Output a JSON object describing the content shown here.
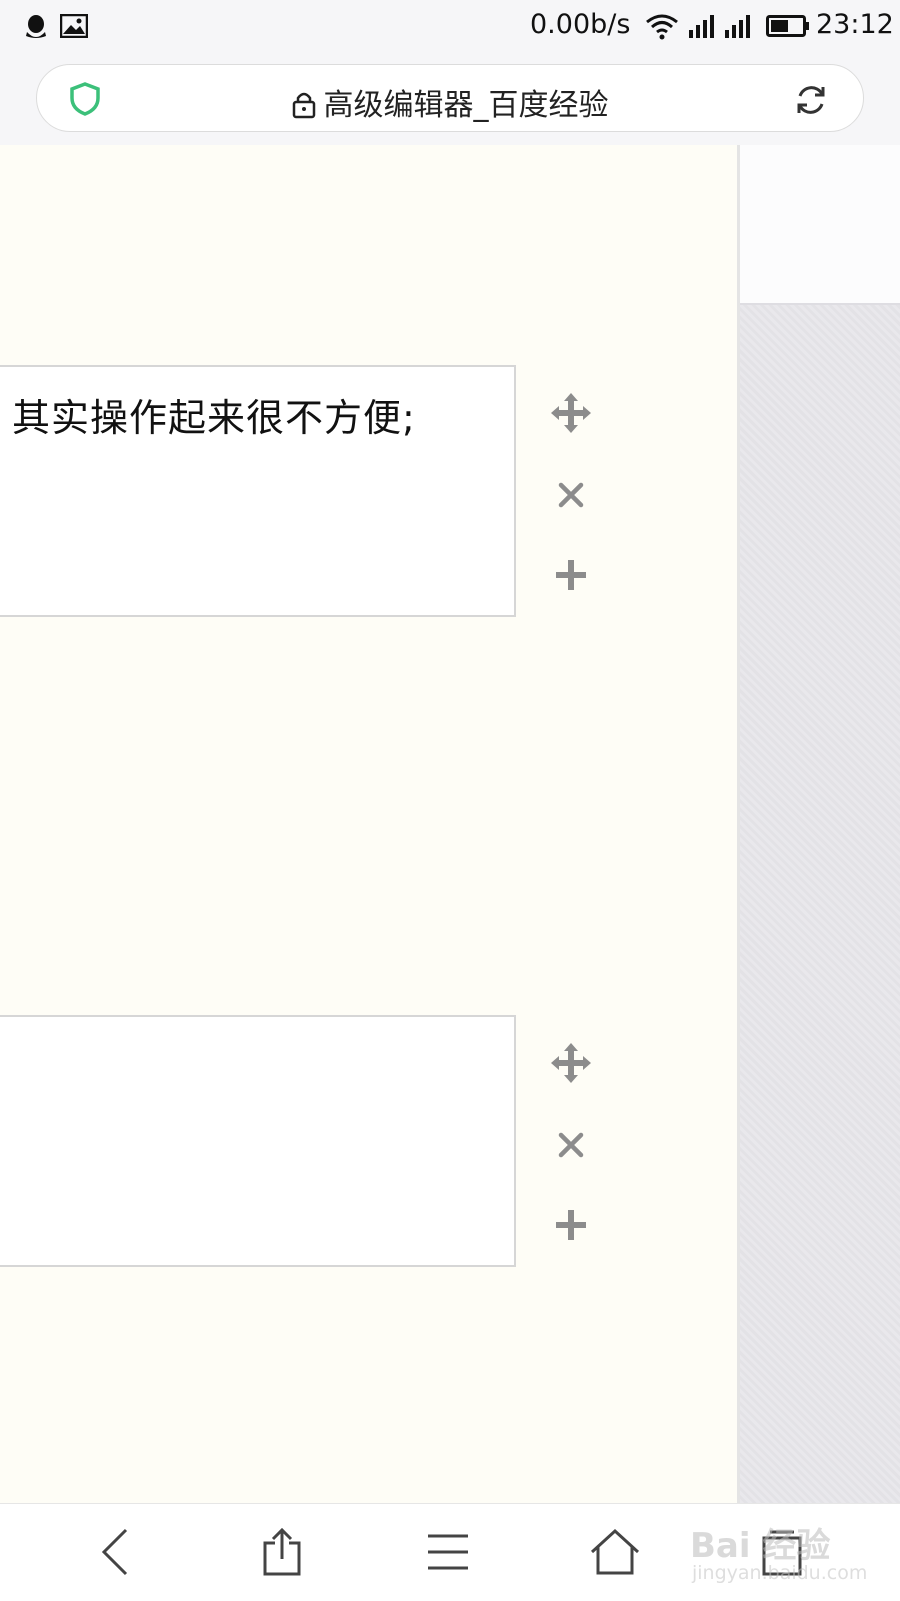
{
  "status_bar": {
    "net_speed": "0.00b/s",
    "time": "23:12",
    "icons": [
      "qq-icon",
      "image-icon",
      "wifi-icon",
      "signal-icon",
      "signal-icon",
      "battery-icon"
    ]
  },
  "address_bar": {
    "title": "高级编辑器_百度经验",
    "icons": [
      "shield-icon",
      "lock-icon",
      "refresh-icon"
    ]
  },
  "editor": {
    "blocks": [
      {
        "text": "其实操作起来很不方便;"
      },
      {
        "text": ""
      }
    ],
    "tools": [
      "move-icon",
      "close-icon",
      "plus-icon"
    ]
  },
  "bottom_nav": {
    "items": [
      "back",
      "share",
      "menu",
      "home",
      "tabs"
    ]
  },
  "watermark": {
    "brand": "Bai 经验",
    "url": "jingyan.baidu.com"
  },
  "colors": {
    "main_bg": "#fefdf6",
    "shield_green": "#3cc07a",
    "tool_gray": "#8c8c8c"
  }
}
